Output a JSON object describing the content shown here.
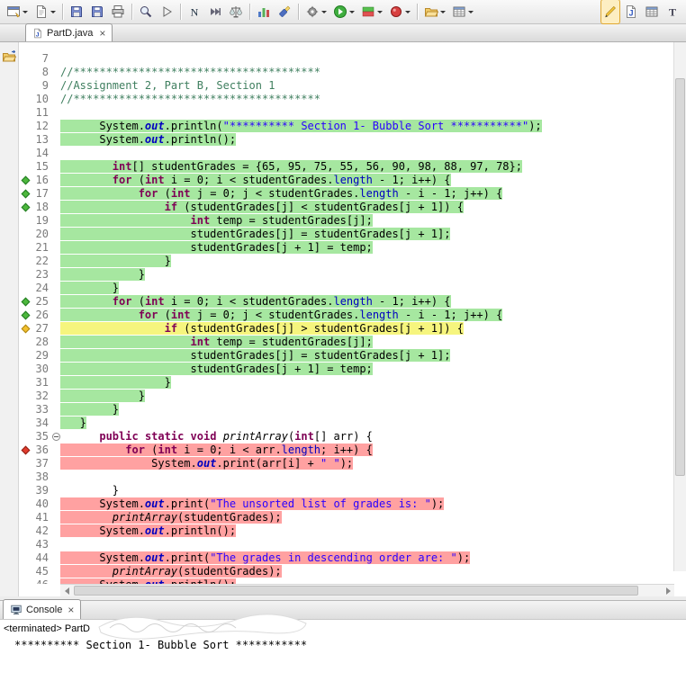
{
  "colors": {
    "cov-green": "#a6e7a0",
    "cov-yellow": "#f6f57e",
    "cov-red": "#ffa1a1",
    "kw": "#7f0055",
    "str": "#2a00ff",
    "cm": "#3f7f5f",
    "fld": "#0000c0",
    "marker-green": "#4db83d",
    "marker-yellow": "#f2c02e",
    "marker-red": "#e23b2e"
  },
  "toolbar": {
    "items": [
      {
        "type": "button",
        "name": "new-wizard",
        "icon": "window",
        "dropdown": true
      },
      {
        "type": "button",
        "name": "new-file",
        "icon": "doc",
        "dropdown": true
      },
      {
        "type": "sep"
      },
      {
        "type": "button",
        "name": "save",
        "icon": "save"
      },
      {
        "type": "button",
        "name": "save-all",
        "icon": "save"
      },
      {
        "type": "button",
        "name": "print",
        "icon": "print"
      },
      {
        "type": "sep"
      },
      {
        "type": "button",
        "name": "magnifier",
        "icon": "zoom"
      },
      {
        "type": "button",
        "name": "run-last",
        "icon": "play-outline"
      },
      {
        "type": "sep"
      },
      {
        "type": "button",
        "name": "letter-n",
        "icon": "letterN"
      },
      {
        "type": "button",
        "name": "fast-forward",
        "icon": "skip"
      },
      {
        "type": "button",
        "name": "scales",
        "icon": "scales"
      },
      {
        "type": "sep"
      },
      {
        "type": "button",
        "name": "chart",
        "icon": "chart"
      },
      {
        "type": "button",
        "name": "flashlight-search",
        "icon": "flashlight"
      },
      {
        "type": "sep"
      },
      {
        "type": "button",
        "name": "external-tools",
        "icon": "gear",
        "dropdown": true
      },
      {
        "type": "button",
        "name": "run",
        "icon": "run",
        "dropdown": true
      },
      {
        "type": "button",
        "name": "coverage",
        "icon": "coverage",
        "dropdown": true
      },
      {
        "type": "button",
        "name": "profile",
        "icon": "profile",
        "dropdown": true
      },
      {
        "type": "sep"
      },
      {
        "type": "button",
        "name": "open-folder",
        "icon": "folder",
        "dropdown": true
      },
      {
        "type": "button",
        "name": "open-table",
        "icon": "grid",
        "dropdown": true
      },
      {
        "type": "spacer"
      },
      {
        "type": "button",
        "name": "highlighter",
        "icon": "highlighter",
        "active": true
      },
      {
        "type": "button",
        "name": "java-file",
        "icon": "javadoc"
      },
      {
        "type": "button",
        "name": "table",
        "icon": "grid"
      },
      {
        "type": "button",
        "name": "letter-t",
        "icon": "letterT"
      }
    ]
  },
  "editor_tab": {
    "label": "PartD.java",
    "close_glyph": "×"
  },
  "editor": {
    "lines": [
      {
        "n": 7
      },
      {
        "n": 8,
        "segs": [
          [
            "cm",
            "//**************************************"
          ]
        ]
      },
      {
        "n": 9,
        "segs": [
          [
            "cm",
            "//Assignment 2, Part B, Section 1"
          ]
        ]
      },
      {
        "n": 10,
        "segs": [
          [
            "cm",
            "//**************************************"
          ]
        ]
      },
      {
        "n": 11
      },
      {
        "n": 12,
        "hl": "g",
        "segs": [
          [
            "pl",
            "      System."
          ],
          [
            "sfld",
            "out"
          ],
          [
            "pl",
            ".println("
          ],
          [
            "str",
            "\"********** Section 1- Bubble Sort ***********\""
          ],
          [
            "pl",
            ");"
          ]
        ]
      },
      {
        "n": 13,
        "hl": "g",
        "segs": [
          [
            "pl",
            "      System."
          ],
          [
            "sfld",
            "out"
          ],
          [
            "pl",
            ".println();"
          ]
        ]
      },
      {
        "n": 14
      },
      {
        "n": 15,
        "hl": "g",
        "segs": [
          [
            "pl",
            "        "
          ],
          [
            "kw",
            "int"
          ],
          [
            "pl",
            "[] studentGrades = {65, 95, 75, 55, 56, 90, 98, 88, 97, 78};"
          ]
        ]
      },
      {
        "n": 16,
        "hl": "g",
        "m": "g",
        "segs": [
          [
            "pl",
            "        "
          ],
          [
            "kw",
            "for"
          ],
          [
            "pl",
            " ("
          ],
          [
            "kw",
            "int"
          ],
          [
            "pl",
            " i = 0; i < studentGrades."
          ],
          [
            "fld",
            "length"
          ],
          [
            "pl",
            " - 1; i++) {"
          ]
        ]
      },
      {
        "n": 17,
        "hl": "g",
        "m": "g",
        "segs": [
          [
            "pl",
            "            "
          ],
          [
            "kw",
            "for"
          ],
          [
            "pl",
            " ("
          ],
          [
            "kw",
            "int"
          ],
          [
            "pl",
            " j = 0; j < studentGrades."
          ],
          [
            "fld",
            "length"
          ],
          [
            "pl",
            " - i - 1; j++) {"
          ]
        ]
      },
      {
        "n": 18,
        "hl": "g",
        "m": "g",
        "segs": [
          [
            "pl",
            "                "
          ],
          [
            "kw",
            "if"
          ],
          [
            "pl",
            " (studentGrades[j] < studentGrades[j + 1]) {"
          ]
        ]
      },
      {
        "n": 19,
        "hl": "g",
        "segs": [
          [
            "pl",
            "                    "
          ],
          [
            "kw",
            "int"
          ],
          [
            "pl",
            " temp = studentGrades[j];"
          ]
        ]
      },
      {
        "n": 20,
        "hl": "g",
        "segs": [
          [
            "pl",
            "                    studentGrades[j] = studentGrades[j + 1];"
          ]
        ]
      },
      {
        "n": 21,
        "hl": "g",
        "segs": [
          [
            "pl",
            "                    studentGrades[j + 1] = temp;"
          ]
        ]
      },
      {
        "n": 22,
        "hl": "g",
        "segs": [
          [
            "pl",
            "                }"
          ]
        ]
      },
      {
        "n": 23,
        "hl": "g",
        "segs": [
          [
            "pl",
            "            }"
          ]
        ]
      },
      {
        "n": 24,
        "hl": "g",
        "segs": [
          [
            "pl",
            "        }"
          ]
        ]
      },
      {
        "n": 25,
        "hl": "g",
        "m": "g",
        "segs": [
          [
            "pl",
            "        "
          ],
          [
            "kw",
            "for"
          ],
          [
            "pl",
            " ("
          ],
          [
            "kw",
            "int"
          ],
          [
            "pl",
            " i = 0; i < studentGrades."
          ],
          [
            "fld",
            "length"
          ],
          [
            "pl",
            " - 1; i++) {"
          ]
        ]
      },
      {
        "n": 26,
        "hl": "g",
        "m": "g",
        "segs": [
          [
            "pl",
            "            "
          ],
          [
            "kw",
            "for"
          ],
          [
            "pl",
            " ("
          ],
          [
            "kw",
            "int"
          ],
          [
            "pl",
            " j = 0; j < studentGrades."
          ],
          [
            "fld",
            "length"
          ],
          [
            "pl",
            " - i - 1; j++) {"
          ]
        ]
      },
      {
        "n": 27,
        "hl": "y",
        "m": "y",
        "segs": [
          [
            "pl",
            "                "
          ],
          [
            "kw",
            "if"
          ],
          [
            "pl",
            " (studentGrades[j] > studentGrades[j + 1]) {"
          ]
        ]
      },
      {
        "n": 28,
        "hl": "g",
        "segs": [
          [
            "pl",
            "                    "
          ],
          [
            "kw",
            "int"
          ],
          [
            "pl",
            " temp = studentGrades[j];"
          ]
        ]
      },
      {
        "n": 29,
        "hl": "g",
        "segs": [
          [
            "pl",
            "                    studentGrades[j] = studentGrades[j + 1];"
          ]
        ]
      },
      {
        "n": 30,
        "hl": "g",
        "segs": [
          [
            "pl",
            "                    studentGrades[j + 1] = temp;"
          ]
        ]
      },
      {
        "n": 31,
        "hl": "g",
        "segs": [
          [
            "pl",
            "                }"
          ]
        ]
      },
      {
        "n": 32,
        "hl": "g",
        "segs": [
          [
            "pl",
            "            }"
          ]
        ]
      },
      {
        "n": 33,
        "hl": "g",
        "segs": [
          [
            "pl",
            "        }"
          ]
        ]
      },
      {
        "n": 34,
        "hl": "g",
        "segs": [
          [
            "pl",
            "   }"
          ]
        ]
      },
      {
        "n": 35,
        "fold": true,
        "segs": [
          [
            "pl",
            "      "
          ],
          [
            "kw",
            "public"
          ],
          [
            "pl",
            " "
          ],
          [
            "kw",
            "static"
          ],
          [
            "pl",
            " "
          ],
          [
            "kw",
            "void"
          ],
          [
            "pl",
            " "
          ],
          [
            "smeth",
            "printArray"
          ],
          [
            "pl",
            "("
          ],
          [
            "kw",
            "int"
          ],
          [
            "pl",
            "[] arr) {"
          ]
        ]
      },
      {
        "n": 36,
        "hl": "r",
        "m": "r",
        "segs": [
          [
            "pl",
            "          "
          ],
          [
            "kw",
            "for"
          ],
          [
            "pl",
            " ("
          ],
          [
            "kw",
            "int"
          ],
          [
            "pl",
            " i = 0; i < arr."
          ],
          [
            "fld",
            "length"
          ],
          [
            "pl",
            "; i++) {"
          ]
        ]
      },
      {
        "n": 37,
        "hl": "r",
        "segs": [
          [
            "pl",
            "              System."
          ],
          [
            "sfld",
            "out"
          ],
          [
            "pl",
            ".print(arr[i] + "
          ],
          [
            "str",
            "\" \""
          ],
          [
            "pl",
            ");"
          ]
        ]
      },
      {
        "n": 38
      },
      {
        "n": 39,
        "segs": [
          [
            "pl",
            "        }"
          ]
        ]
      },
      {
        "n": 40,
        "hl": "r",
        "segs": [
          [
            "pl",
            "      System."
          ],
          [
            "sfld",
            "out"
          ],
          [
            "pl",
            ".print("
          ],
          [
            "str",
            "\"The unsorted list of grades is: \""
          ],
          [
            "pl",
            ");"
          ]
        ]
      },
      {
        "n": 41,
        "hl": "r",
        "segs": [
          [
            "pl",
            "        "
          ],
          [
            "smeth",
            "printArray"
          ],
          [
            "pl",
            "(studentGrades);"
          ]
        ]
      },
      {
        "n": 42,
        "hl": "r",
        "segs": [
          [
            "pl",
            "      System."
          ],
          [
            "sfld",
            "out"
          ],
          [
            "pl",
            ".println();"
          ]
        ]
      },
      {
        "n": 43
      },
      {
        "n": 44,
        "hl": "r",
        "segs": [
          [
            "pl",
            "      System."
          ],
          [
            "sfld",
            "out"
          ],
          [
            "pl",
            ".print("
          ],
          [
            "str",
            "\"The grades in descending order are: \""
          ],
          [
            "pl",
            ");"
          ]
        ]
      },
      {
        "n": 45,
        "hl": "r",
        "segs": [
          [
            "pl",
            "        "
          ],
          [
            "smeth",
            "printArray"
          ],
          [
            "pl",
            "(studentGrades);"
          ]
        ]
      },
      {
        "n": 46,
        "hl": "r",
        "segs": [
          [
            "pl",
            "      System."
          ],
          [
            "sfld",
            "out"
          ],
          [
            "pl",
            ".println();"
          ]
        ]
      }
    ]
  },
  "console": {
    "tab_label": "Console",
    "close_glyph": "×",
    "status": "<terminated> PartD",
    "output": "********** Section 1- Bubble Sort ***********"
  }
}
